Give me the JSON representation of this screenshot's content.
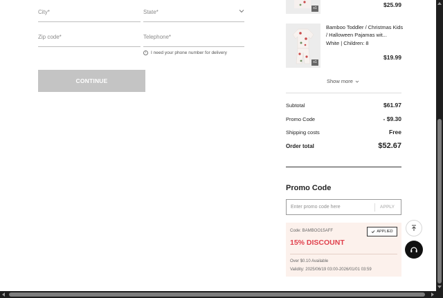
{
  "form": {
    "city_placeholder": "City*",
    "state_placeholder": "State*",
    "zip_placeholder": "Zip code*",
    "telephone_placeholder": "Telephone*",
    "phone_hint": "I need your phone number for delivery",
    "continue_label": "CONTINUE"
  },
  "cart": {
    "items": [
      {
        "price": "$25.99",
        "qty": "x1"
      },
      {
        "name": "Bamboo Toddler / Christmas Kids / Halloween Pajamas wit...",
        "variant": "White | Children: 8",
        "price": "$19.99",
        "qty": "x1"
      }
    ],
    "show_more": "Show more"
  },
  "summary": {
    "subtotal_label": "Subtotal",
    "subtotal": "$61.97",
    "promo_label": "Promo Code",
    "promo": "- $9.30",
    "shipping_label": "Shipping costs",
    "shipping": "Free",
    "total_label": "Order total",
    "total": "$52.67"
  },
  "promo": {
    "title": "Promo Code",
    "placeholder": "Enter promo code here",
    "apply_label": "APPLY",
    "coupon": {
      "code": "Code: BAMBOO15AFF",
      "applied_label": "APPLIED",
      "discount": "15% DISCOUNT",
      "availability": "Over $0.10 Available",
      "validity": "Validity: 2025/06/19 03:00-2026/01/01 03:59"
    }
  },
  "colors": {
    "discount_red": "#e0404c",
    "coupon_bg": "#fcf1ec",
    "continue_disabled": "#c4c4c4"
  }
}
